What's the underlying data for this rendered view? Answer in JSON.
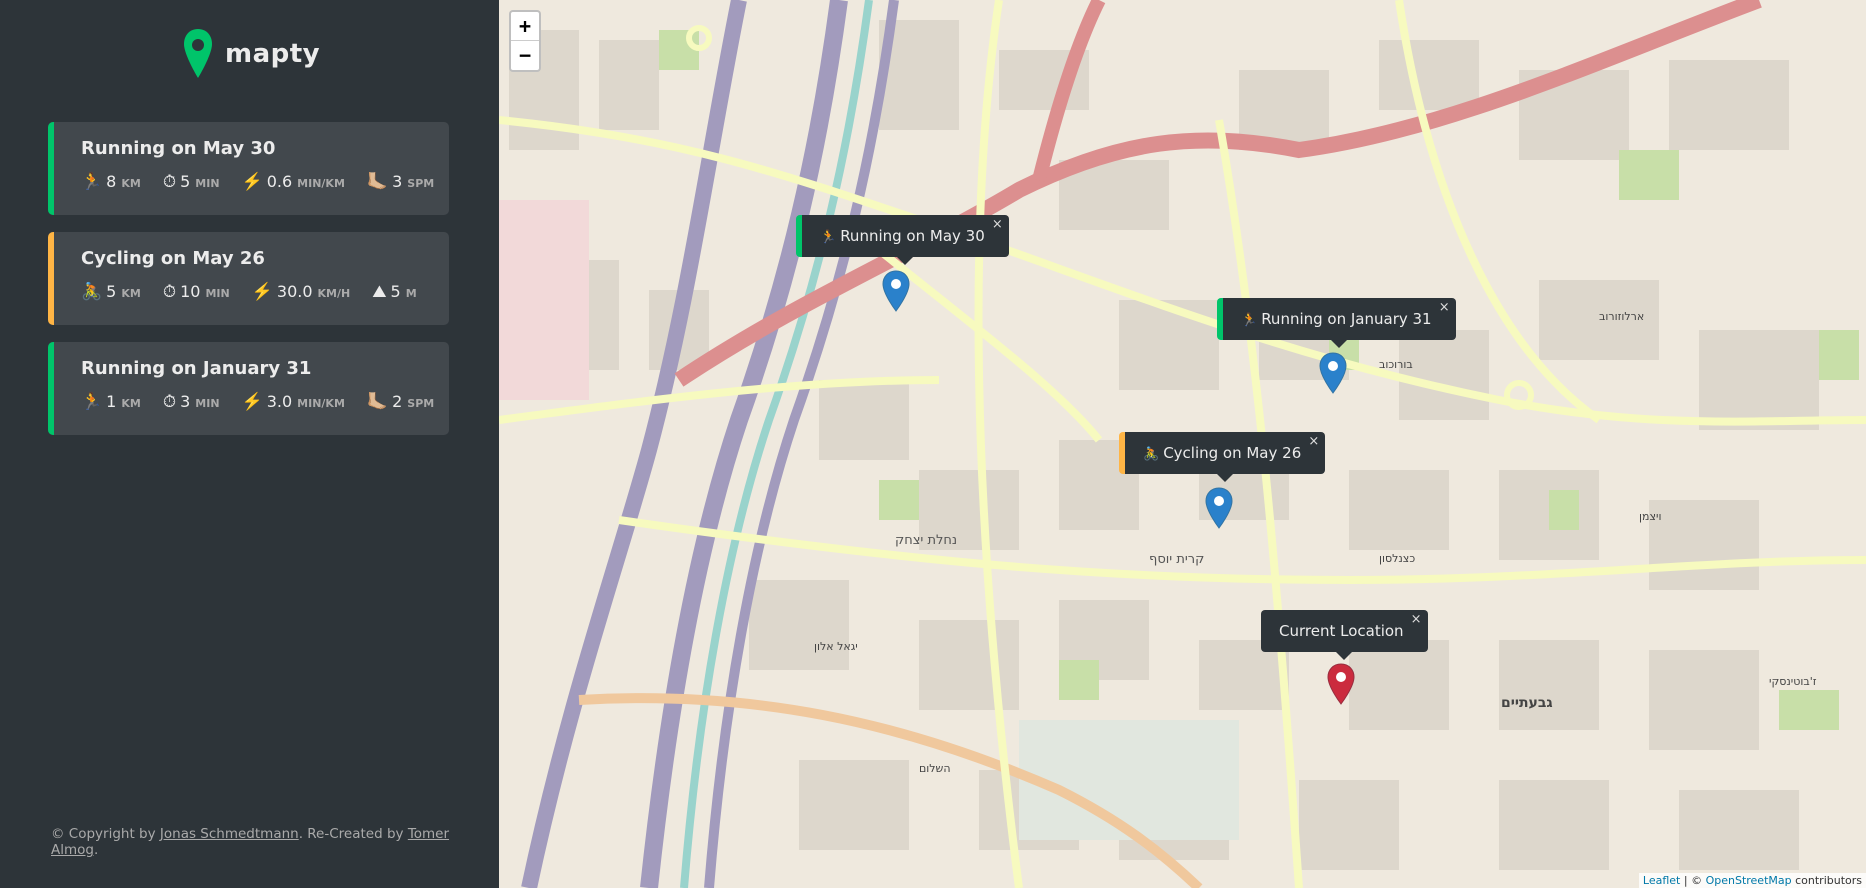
{
  "logo": {
    "text": "mapty"
  },
  "workouts": [
    {
      "type": "running",
      "title": "Running on May 30",
      "details": [
        {
          "icon": "🏃",
          "value": "8",
          "unit": "km"
        },
        {
          "icon": "⏱",
          "value": "5",
          "unit": "min"
        },
        {
          "icon": "⚡️",
          "value": "0.6",
          "unit": "min/km"
        },
        {
          "icon": "🦶🏼",
          "value": "3",
          "unit": "spm"
        }
      ]
    },
    {
      "type": "cycling",
      "title": "Cycling on May 26",
      "details": [
        {
          "icon": "🚴",
          "value": "5",
          "unit": "km"
        },
        {
          "icon": "⏱",
          "value": "10",
          "unit": "min"
        },
        {
          "icon": "⚡️",
          "value": "30.0",
          "unit": "km/h"
        },
        {
          "icon": "⛰",
          "value": "5",
          "unit": "m"
        }
      ]
    },
    {
      "type": "running",
      "title": "Running on January 31",
      "details": [
        {
          "icon": "🏃",
          "value": "1",
          "unit": "km"
        },
        {
          "icon": "⏱",
          "value": "3",
          "unit": "min"
        },
        {
          "icon": "⚡️",
          "value": "3.0",
          "unit": "min/km"
        },
        {
          "icon": "🦶🏼",
          "value": "2",
          "unit": "spm"
        }
      ]
    }
  ],
  "copyright": {
    "prefix": "© Copyright by ",
    "author": "Jonas Schmedtmann",
    "middle": ". Re-Created by ",
    "recreator": "Tomer Almog",
    "suffix": "."
  },
  "map": {
    "zoom_in": "+",
    "zoom_out": "−",
    "popups": {
      "p1": {
        "icon": "🏃",
        "label": "Running on May 30",
        "type": "running"
      },
      "p2": {
        "icon": "🏃",
        "label": "Running on January 31",
        "type": "running"
      },
      "p3": {
        "icon": "🚴",
        "label": "Cycling on May 26",
        "type": "cycling"
      },
      "p4": {
        "label": "Current Location",
        "type": "current"
      }
    },
    "close_glyph": "×",
    "labels": [
      "גבעתיים",
      "נחלת יצחק",
      "קרית יוסף",
      "כצנלסון",
      "ויצמן",
      "בורוכוב",
      "ארלוזורוב",
      "השלום",
      "יגאל אלון",
      "ז'בוטינסקי"
    ],
    "attribution": {
      "leaflet": "Leaflet",
      "sep": " | © ",
      "osm": "OpenStreetMap",
      "suffix": " contributors"
    }
  },
  "colors": {
    "running": "#00c46a",
    "cycling": "#ffb545",
    "sidebar": "#2d3439",
    "card": "#42484d"
  }
}
